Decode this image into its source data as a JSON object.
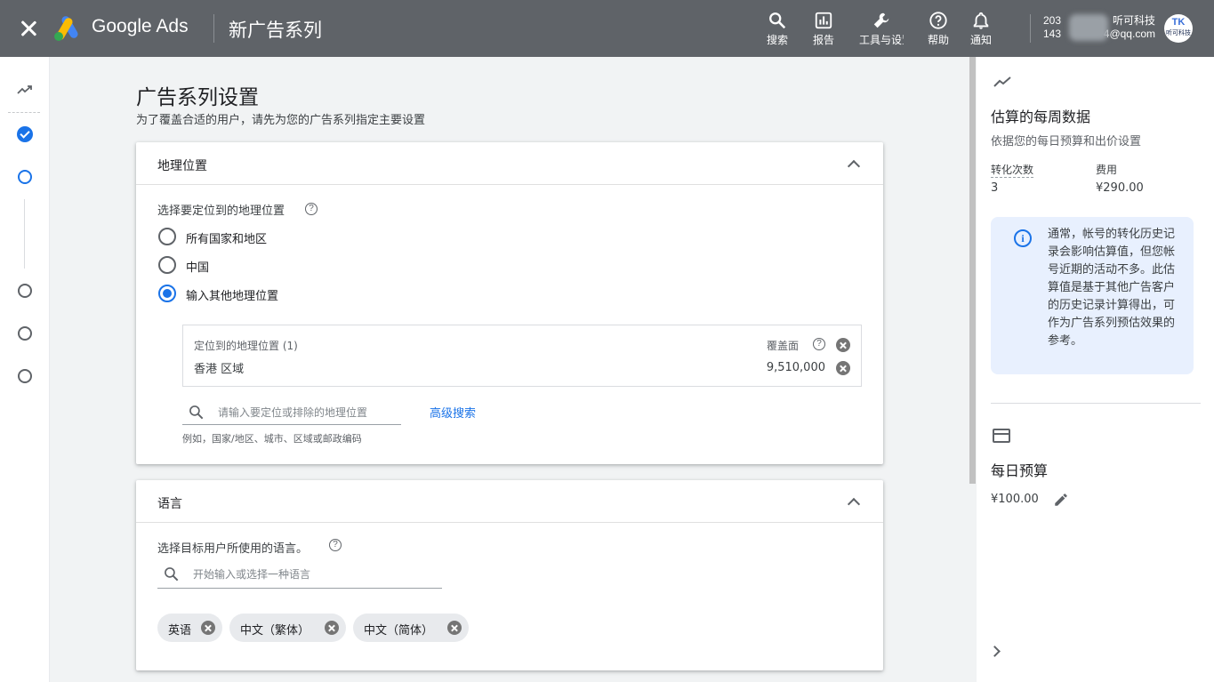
{
  "topbar": {
    "brand": "Google Ads",
    "page_name": "新广告系列",
    "items": [
      {
        "label": "搜索",
        "icon": "search-icon"
      },
      {
        "label": "报告",
        "icon": "reports-icon"
      },
      {
        "label": "工具与设置",
        "icon": "wrench-icon"
      },
      {
        "label": "帮助",
        "icon": "help-icon"
      },
      {
        "label": "通知",
        "icon": "bell-icon"
      }
    ],
    "account": {
      "line1_left": "203",
      "line1_right": "听可科技",
      "line2_left": "143",
      "line2_right": "4@qq.com"
    },
    "avatar_text": "听可科技",
    "avatar_mark": "TK"
  },
  "main": {
    "title": "广告系列设置",
    "subtitle": "为了覆盖合适的用户，请先为您的广告系列指定主要设置"
  },
  "geo": {
    "title": "地理位置",
    "prompt": "选择要定位到的地理位置",
    "options": [
      {
        "label": "所有国家和地区",
        "checked": false
      },
      {
        "label": "中国",
        "checked": false
      },
      {
        "label": "输入其他地理位置",
        "checked": true
      }
    ],
    "targeted_header": "定位到的地理位置 (1)",
    "reach_label": "覆盖面",
    "location_name": "香港 区域",
    "location_reach": "9,510,000",
    "search_placeholder": "请输入要定位或排除的地理位置",
    "advanced_search": "高级搜索",
    "hint": "例如，国家/地区、城市、区域或邮政编码"
  },
  "language": {
    "title": "语言",
    "prompt": "选择目标用户所使用的语言。",
    "search_placeholder": "开始输入或选择一种语言",
    "chips": [
      "英语",
      "中文（繁体）",
      "中文（简体）"
    ]
  },
  "right_panel": {
    "title": "估算的每周数据",
    "subtitle": "依据您的每日预算和出价设置",
    "stats": [
      {
        "label": "转化次数",
        "value": "3"
      },
      {
        "label": "费用",
        "value": "¥290.00"
      }
    ],
    "info": "通常，帐号的转化历史记录会影响估算值，但您帐号近期的活动不多。此估算值是基于其他广告客户的历史记录计算得出，可作为广告系列预估效果的参考。",
    "budget_title": "每日预算",
    "budget_value": "¥100.00"
  },
  "colors": {
    "topbar": "#5f6368",
    "accent": "#1a73e8",
    "info_bg": "#e8f0fe"
  }
}
